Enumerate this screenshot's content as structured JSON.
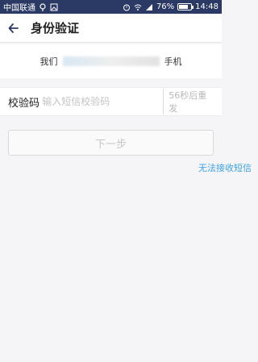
{
  "statusbar": {
    "carrier": "中国联通",
    "battery": "76%",
    "time": "14:48"
  },
  "appbar": {
    "title": "身份验证"
  },
  "hint": {
    "prefix": "我们",
    "suffix": "手机"
  },
  "form": {
    "code_label": "校验码",
    "code_placeholder": "输入短信校验码",
    "resend": "56秒后重发"
  },
  "actions": {
    "next": "下一步",
    "no_sms": "无法接收短信"
  },
  "colors": {
    "status_bg": "#2b3a64",
    "link": "#3ca2e4"
  }
}
